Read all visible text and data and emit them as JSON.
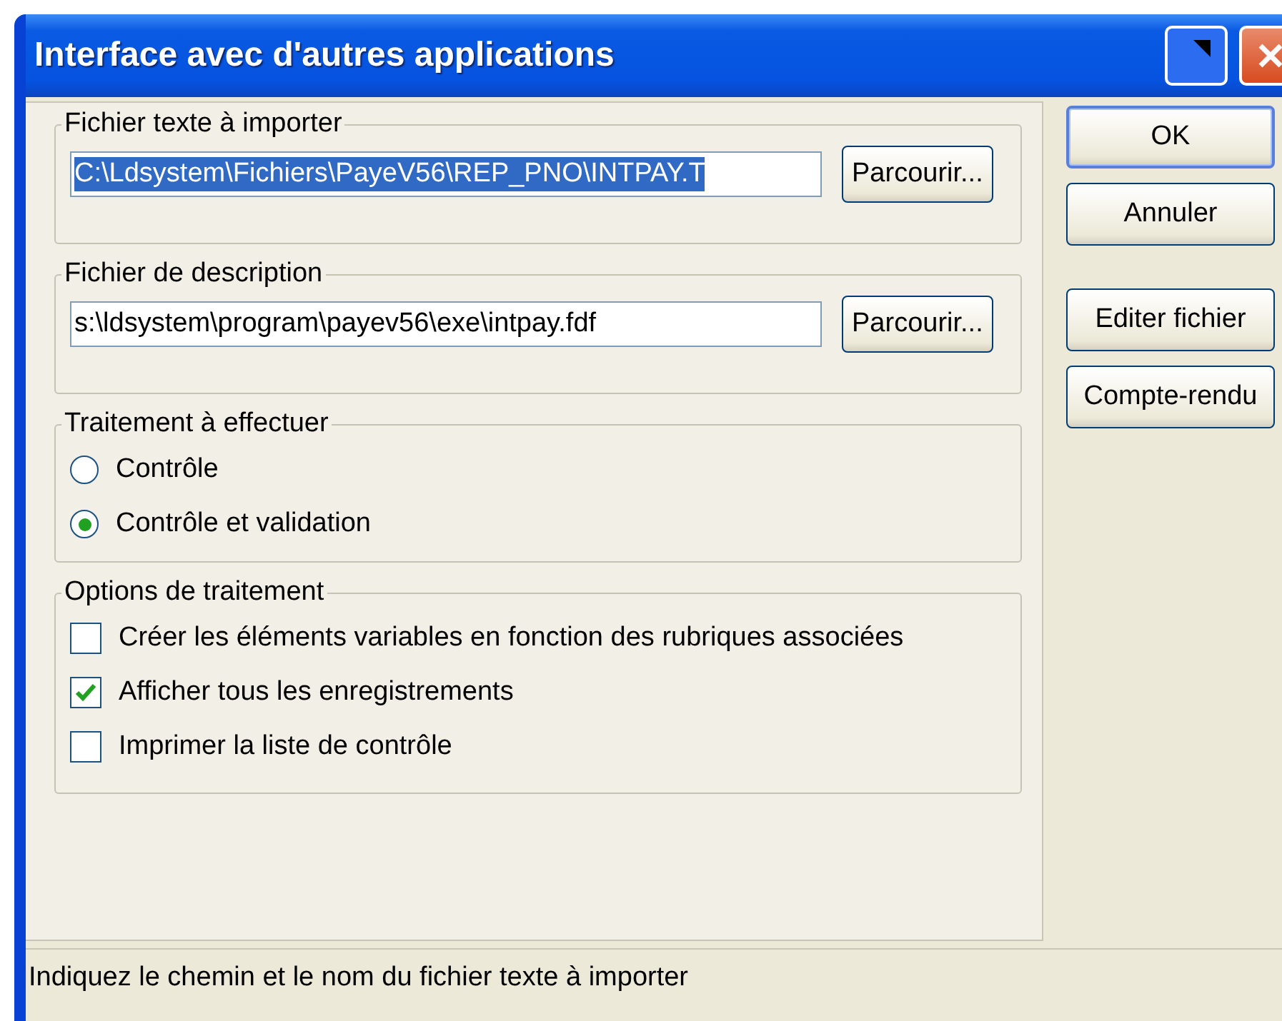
{
  "window": {
    "title": "Interface avec d'autres applications",
    "title_buttons": [
      {
        "kind": "help"
      },
      {
        "kind": "close"
      }
    ]
  },
  "groups": [
    {
      "kind": "file",
      "label": "Fichier texte à importer",
      "value": "C:\\Ldsystem\\Fichiers\\PayeV56\\REP_PNO\\INTPAY.T",
      "text_selected": true,
      "button": "Parcourir..."
    },
    {
      "kind": "file",
      "label": "Fichier de description",
      "value": "s:\\ldsystem\\program\\payev56\\exe\\intpay.fdf",
      "text_selected": false,
      "button": "Parcourir..."
    },
    {
      "kind": "radio",
      "label": "Traitement à effectuer",
      "options": [
        {
          "label": "Contrôle",
          "selected": false
        },
        {
          "label": "Contrôle et validation",
          "selected": true
        }
      ]
    },
    {
      "kind": "check",
      "label": "Options de traitement",
      "options": [
        {
          "label": "Créer les éléments variables en fonction des rubriques associées",
          "checked": false
        },
        {
          "label": "Afficher tous les enregistrements",
          "checked": true
        },
        {
          "label": "Imprimer la liste de contrôle",
          "checked": false
        }
      ]
    }
  ],
  "buttons": [
    {
      "label": "OK",
      "default": true
    },
    {
      "label": "Annuler",
      "default": false
    },
    {
      "label": "Editer fichier",
      "default": false
    },
    {
      "label": "Compte-rendu",
      "default": false
    }
  ],
  "status_bar": "Indiquez le chemin et le nom du fichier texte à importer"
}
